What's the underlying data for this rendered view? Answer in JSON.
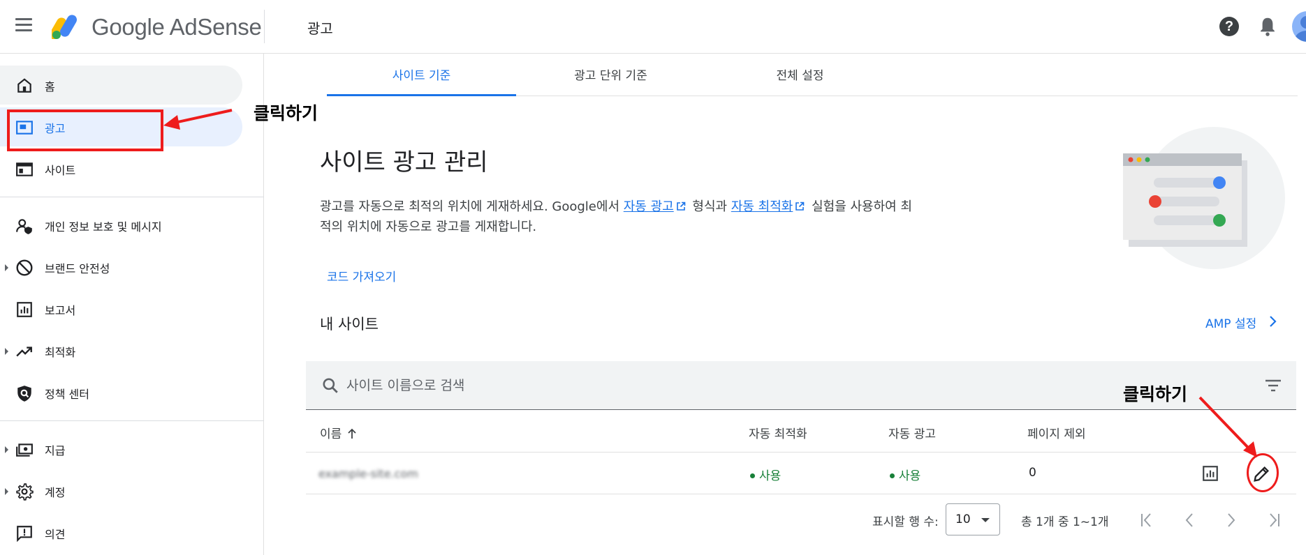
{
  "app": {
    "brand": "Google AdSense",
    "page_heading": "광고"
  },
  "colors": {
    "accent": "#1a73e8",
    "active_bg": "#e8f0fe",
    "status_green": "#188038",
    "annotation": "#ee1c1c"
  },
  "header": {
    "icons": [
      "menu-icon",
      "adsense-logo",
      "help-icon",
      "notifications-icon",
      "avatar"
    ]
  },
  "sidebar": {
    "items": [
      {
        "label": "홈",
        "icon": "home-icon"
      },
      {
        "label": "광고",
        "icon": "ads-icon",
        "active": true
      },
      {
        "label": "사이트",
        "icon": "sites-icon"
      },
      {
        "label": "개인 정보 보호 및 메시지",
        "icon": "privacy-icon"
      },
      {
        "label": "브랜드 안전성",
        "icon": "block-icon",
        "expandable": true
      },
      {
        "label": "보고서",
        "icon": "reports-icon"
      },
      {
        "label": "최적화",
        "icon": "trending-icon",
        "expandable": true
      },
      {
        "label": "정책 센터",
        "icon": "policy-shield-icon"
      },
      {
        "label": "지급",
        "icon": "payments-icon",
        "expandable": true
      },
      {
        "label": "계정",
        "icon": "settings-icon",
        "expandable": true
      },
      {
        "label": "의견",
        "icon": "feedback-icon"
      }
    ]
  },
  "tabs": [
    {
      "label": "사이트 기준",
      "active": true
    },
    {
      "label": "광고 단위 기준"
    },
    {
      "label": "전체 설정"
    }
  ],
  "main": {
    "title": "사이트 광고 관리",
    "desc_before": "광고를 자동으로 최적의 위치에 게재하세요. Google에서 ",
    "desc_link1": "자동 광고",
    "desc_middle": " 형식과 ",
    "desc_link2": "자동 최적화",
    "desc_after": " 실험을 사용하여 최적의 위치에 자동으로 광고를 게재합니다.",
    "code_button": "코드 가져오기",
    "my_sites": "내 사이트",
    "amp_link": "AMP 설정"
  },
  "search": {
    "placeholder": "사이트 이름으로 검색"
  },
  "table": {
    "headers": [
      "이름",
      "자동 최적화",
      "자동 광고",
      "페이지 제외"
    ],
    "rows": [
      {
        "name": "example-site.com",
        "auto_optimize": "사용",
        "auto_ads": "사용",
        "page_exclusions": "0"
      }
    ]
  },
  "pagination": {
    "rows_label": "표시할 행 수:",
    "rows_value": "10",
    "range": "총 1개 중 1~1개"
  },
  "annotations": {
    "click_label_1": "클릭하기",
    "click_label_2": "클릭하기"
  }
}
